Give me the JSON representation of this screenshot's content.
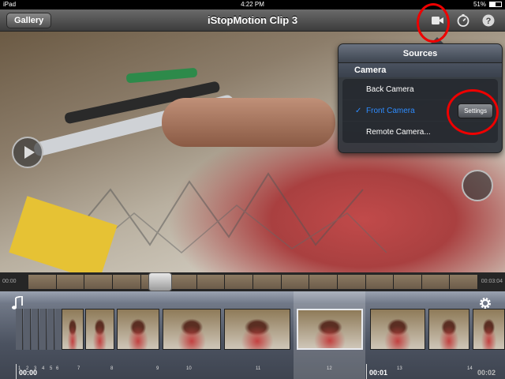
{
  "status_bar": {
    "device": "iPad",
    "time": "4:22 PM",
    "battery": "51%"
  },
  "nav": {
    "gallery_label": "Gallery",
    "title": "iStopMotion Clip 3"
  },
  "popover": {
    "title": "Sources",
    "section": "Camera",
    "items": [
      {
        "label": "Back Camera",
        "selected": false
      },
      {
        "label": "Front Camera",
        "selected": true
      },
      {
        "label": "Remote Camera..."
      }
    ],
    "settings_label": "Settings",
    "check": "✓"
  },
  "scrubber": {
    "start_time": "00:00",
    "end_time": "00:03:04"
  },
  "timeline": {
    "thin_frame_numbers": [
      "1",
      "2",
      "3",
      "4",
      "5",
      "6"
    ],
    "frame_numbers": [
      "7",
      "8",
      "9",
      "10",
      "11",
      "12",
      "13",
      "14"
    ],
    "selected_frame": "12",
    "timestamps": [
      "00:00",
      "00:01",
      "00:02"
    ]
  },
  "colors": {
    "accent": "#2e8cff",
    "annotation": "#e00000"
  }
}
